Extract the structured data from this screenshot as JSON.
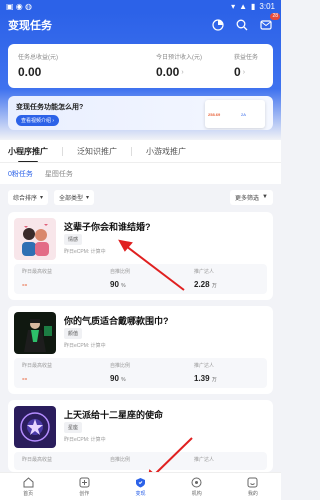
{
  "status_bar": {
    "time": "3:01"
  },
  "app_bar": {
    "title": "变现任务",
    "badge": "28"
  },
  "earnings": {
    "total_label": "任务总收益(元)",
    "total_value": "0.00",
    "today_label": "今日预计收入(元)",
    "today_value": "0.00",
    "tasks_label": "获益任务",
    "tasks_value": "0"
  },
  "banner": {
    "title": "变现任务功能怎么用?",
    "button": "查看视频介绍 ›",
    "phone_values": [
      "258.69",
      "2A"
    ]
  },
  "tabs": [
    {
      "label": "小程序推广"
    },
    {
      "label": "泛知识推广"
    },
    {
      "label": "小游戏推广"
    }
  ],
  "subtabs": [
    {
      "label": "0粉任务"
    },
    {
      "label": "星图任务"
    }
  ],
  "filters": {
    "sort": "综合排序",
    "category": "全部类型",
    "more": "更多筛选"
  },
  "stat_labels": {
    "max_income": "昨日最高收益",
    "ratio": "自推比例",
    "promoters": "推广达人"
  },
  "cards": [
    {
      "title": "这辈子你会和谁结婚?",
      "tag": "情感",
      "ecpm": "昨日eCPM: 计算中",
      "max_income": "--",
      "ratio": "90",
      "ratio_unit": "%",
      "promoters": "2.28",
      "promoters_unit": "万"
    },
    {
      "title": "你的气质适合戴哪款围巾?",
      "tag": "颜值",
      "ecpm": "昨日eCPM: 计算中",
      "max_income": "--",
      "ratio": "90",
      "ratio_unit": "%",
      "promoters": "1.39",
      "promoters_unit": "万"
    },
    {
      "title": "上天派给十二星座的使命",
      "tag": "星座",
      "ecpm": "昨日eCPM: 计算中",
      "max_income": "",
      "ratio": "",
      "ratio_unit": "",
      "promoters": "",
      "promoters_unit": ""
    }
  ],
  "bottom_nav": [
    {
      "label": "首页"
    },
    {
      "label": "创作"
    },
    {
      "label": "变现"
    },
    {
      "label": "机构"
    },
    {
      "label": "我的"
    }
  ],
  "colors": {
    "primary": "#2c62e8",
    "accent_red": "#e02020",
    "badge": "#e84a3a"
  }
}
